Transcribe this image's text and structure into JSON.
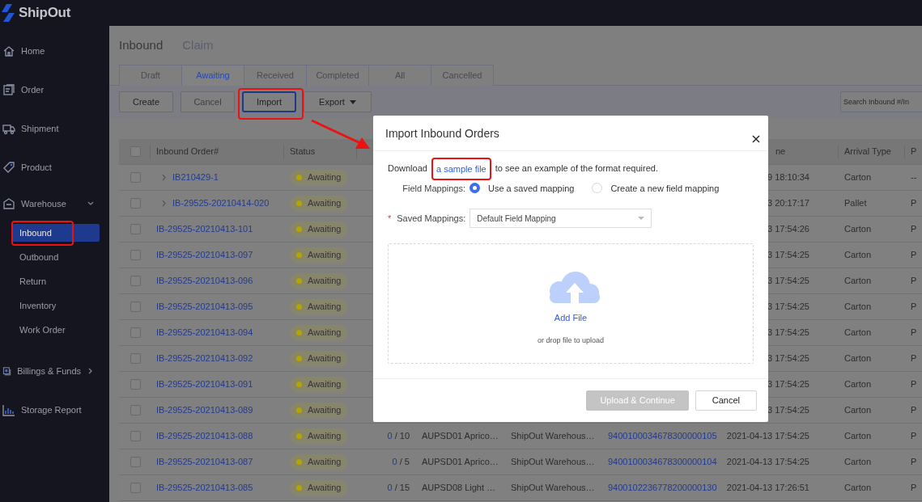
{
  "app": {
    "logo": "ShipOut"
  },
  "sidebar": {
    "items": [
      {
        "label": "Home"
      },
      {
        "label": "Order"
      },
      {
        "label": "Shipment"
      },
      {
        "label": "Product"
      },
      {
        "label": "Warehouse",
        "expanded": true,
        "children": [
          {
            "label": "Inbound",
            "selected": true
          },
          {
            "label": "Outbound",
            "selected": false
          },
          {
            "label": "Return",
            "selected": false
          },
          {
            "label": "Inventory",
            "selected": false
          },
          {
            "label": "Work Order",
            "selected": false
          }
        ]
      },
      {
        "label": "Billings & Funds",
        "expanded": false
      },
      {
        "label": "Storage Report"
      }
    ]
  },
  "page_tabs": [
    {
      "label": "Inbound",
      "selected": true
    },
    {
      "label": "Claim",
      "selected": false
    }
  ],
  "status_tabs": [
    {
      "label": "Draft",
      "selected": false
    },
    {
      "label": "Awaiting",
      "selected": true
    },
    {
      "label": "Received",
      "selected": false
    },
    {
      "label": "Completed",
      "selected": false
    },
    {
      "label": "All",
      "selected": false
    },
    {
      "label": "Cancelled",
      "selected": false
    }
  ],
  "toolbar": {
    "buttons": [
      {
        "label": "Create",
        "kind": "plain",
        "disabled": false,
        "focused": false
      },
      {
        "label": "Cancel",
        "kind": "plain",
        "disabled": true,
        "focused": false
      },
      {
        "label": "Import",
        "kind": "plain",
        "disabled": false,
        "focused": true
      },
      {
        "label": "Export",
        "kind": "dropdown",
        "disabled": false,
        "focused": false
      }
    ],
    "search": {
      "placeholder": "Search Inbound #/In"
    }
  },
  "table": {
    "select_all": {
      "checked": false
    },
    "columns": {
      "order": "Inbound Order#",
      "status": "Status",
      "time": "ne",
      "arrival_type": "Arrival Type",
      "column_10": "P"
    },
    "rows": [
      {
        "checked": false,
        "expandable": true,
        "expanded": false,
        "order": "IB210429-1",
        "status": {
          "label": "Awaiting",
          "color": "#b3a400"
        },
        "time": "9 18:10:34",
        "arrival_type": "Carton",
        "column_10": "--"
      },
      {
        "checked": false,
        "expandable": true,
        "expanded": false,
        "order": "IB-29525-20210414-020",
        "status": {
          "label": "Awaiting",
          "color": "#b3a400"
        },
        "time": "3 20:17:17",
        "arrival_type": "Pallet",
        "column_10": "P"
      },
      {
        "checked": false,
        "order": "IB-29525-20210413-101",
        "status": {
          "label": "Awaiting",
          "color": "#b3a400"
        },
        "time": "3 17:54:26",
        "arrival_type": "Carton",
        "column_10": "P"
      },
      {
        "checked": false,
        "order": "IB-29525-20210413-097",
        "status": {
          "label": "Awaiting",
          "color": "#b3a400"
        },
        "time": "3 17:54:25",
        "arrival_type": "Carton",
        "column_10": "P"
      },
      {
        "checked": false,
        "order": "IB-29525-20210413-096",
        "status": {
          "label": "Awaiting",
          "color": "#b3a400"
        },
        "time": "3 17:54:25",
        "arrival_type": "Carton",
        "column_10": "P"
      },
      {
        "checked": false,
        "order": "IB-29525-20210413-095",
        "status": {
          "label": "Awaiting",
          "color": "#b3a400"
        },
        "time": "3 17:54:25",
        "arrival_type": "Carton",
        "column_10": "P"
      },
      {
        "checked": false,
        "order": "IB-29525-20210413-094",
        "status": {
          "label": "Awaiting",
          "color": "#b3a400"
        },
        "time": "3 17:54:25",
        "arrival_type": "Carton",
        "column_10": "P"
      },
      {
        "checked": false,
        "order": "IB-29525-20210413-092",
        "status": {
          "label": "Awaiting",
          "color": "#b3a400"
        },
        "time": "3 17:54:25",
        "arrival_type": "Carton",
        "column_10": "P"
      },
      {
        "checked": false,
        "order": "IB-29525-20210413-091",
        "status": {
          "label": "Awaiting",
          "color": "#b3a400"
        },
        "time": "3 17:54:25",
        "arrival_type": "Carton",
        "column_10": "P"
      },
      {
        "checked": false,
        "order": "IB-29525-20210413-089",
        "status": {
          "label": "Awaiting",
          "color": "#b3a400"
        },
        "time": "3 17:54:25",
        "arrival_type": "Carton",
        "column_10": "P"
      },
      {
        "checked": false,
        "order": "IB-29525-20210413-088",
        "status": {
          "label": "Awaiting",
          "color": "#b3a400"
        },
        "quantity": {
          "done": "0",
          "rest": "/ 10"
        },
        "product": "AUPSD01 Aprico…",
        "warehouse": "ShipOut Warehous…",
        "tracking": "9400100034678300000105",
        "time": "2021-04-13 17:54:25",
        "arrival_type": "Carton",
        "column_10": "P"
      },
      {
        "checked": false,
        "order": "IB-29525-20210413-087",
        "status": {
          "label": "Awaiting",
          "color": "#b3a400"
        },
        "quantity": {
          "done": "0",
          "rest": "/ 5"
        },
        "product": "AUPSD01 Aprico…",
        "warehouse": "ShipOut Warehous…",
        "tracking": "9400100034678300000104",
        "time": "2021-04-13 17:54:25",
        "arrival_type": "Carton",
        "column_10": "P"
      },
      {
        "checked": false,
        "order": "IB-29525-20210413-085",
        "status": {
          "label": "Awaiting",
          "color": "#b3a400"
        },
        "quantity": {
          "done": "0",
          "rest": "/ 15"
        },
        "product": "AUPSD08 Light …",
        "warehouse": "ShipOut Warehous…",
        "tracking": "9400102236778200000130",
        "time": "2021-04-13 17:26:51",
        "arrival_type": "Carton",
        "column_10": "P"
      }
    ]
  },
  "modal": {
    "title": "Import Inbound Orders",
    "download": {
      "before": "Download",
      "link": "a sample file",
      "after": "to see an example of the format required."
    },
    "field_mappings": {
      "label": "Field Mappings:",
      "options": [
        {
          "label": "Use a saved mapping",
          "selected": true
        },
        {
          "label": "Create a new field mapping",
          "selected": false
        }
      ]
    },
    "saved_mappings": {
      "label": "Saved Mappings:",
      "required_mark": "*",
      "value": "Default Field Mapping"
    },
    "upload": {
      "action": "Add File",
      "hint": "or drop file to upload"
    },
    "buttons": [
      {
        "label": "Upload & Continue",
        "kind": "primary",
        "disabled": true
      },
      {
        "label": "Cancel",
        "kind": "secondary",
        "disabled": false
      }
    ]
  }
}
